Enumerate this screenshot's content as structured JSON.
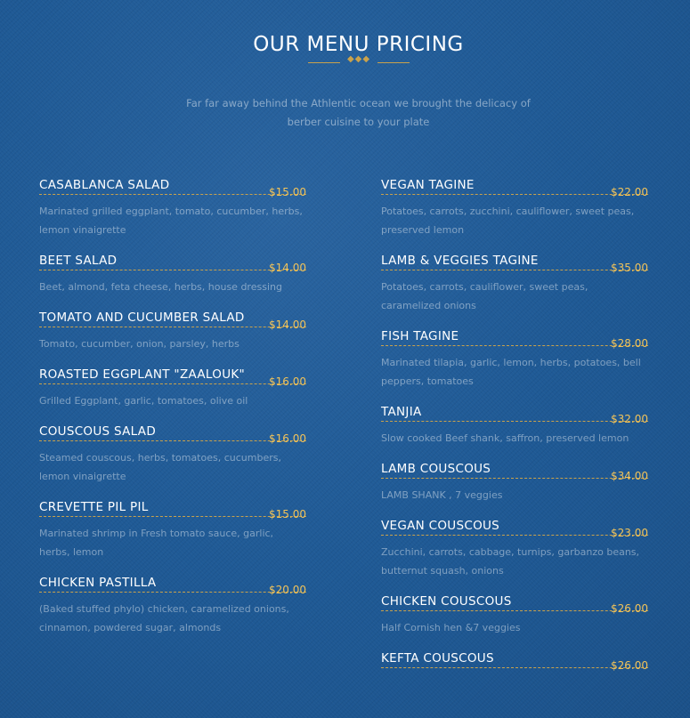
{
  "header": {
    "title": "OUR MENU PRICING",
    "subtitle": "Far far away behind the Athlentic ocean we brought the delicacy of berber cuisine to your plate",
    "divider_glyphs": "◆◆◆"
  },
  "colors": {
    "background": "#1f5a96",
    "accent_gold": "#c9a24c",
    "price": "#f1c35a"
  },
  "menu": {
    "left": [
      {
        "name": "CASABLANCA SALAD",
        "price": "$15.00",
        "desc": "Marinated grilled eggplant, tomato, cucumber, herbs, lemon vinaigrette"
      },
      {
        "name": "BEET SALAD",
        "price": "$14.00",
        "desc": "Beet, almond, feta cheese, herbs, house dressing"
      },
      {
        "name": "TOMATO AND CUCUMBER SALAD",
        "price": "$14.00",
        "desc": "Tomato, cucumber, onion, parsley, herbs"
      },
      {
        "name": "ROASTED EGGPLANT \"ZAALOUK\"",
        "price": "$16.00",
        "desc": "Grilled Eggplant, garlic, tomatoes, olive oil"
      },
      {
        "name": "COUSCOUS SALAD",
        "price": "$16.00",
        "desc": "Steamed couscous, herbs, tomatoes, cucumbers, lemon vinaigrette"
      },
      {
        "name": "CREVETTE PIL PIL",
        "price": "$15.00",
        "desc": "Marinated shrimp in Fresh tomato sauce, garlic, herbs, lemon"
      },
      {
        "name": "CHICKEN PASTILLA",
        "price": "$20.00",
        "desc": "(Baked stuffed phylo) chicken, caramelized onions, cinnamon, powdered sugar, almonds"
      }
    ],
    "right": [
      {
        "name": "VEGAN TAGINE",
        "price": "$22.00",
        "desc": "Potatoes, carrots, zucchini, cauliflower, sweet peas, preserved lemon"
      },
      {
        "name": "LAMB & VEGGIES TAGINE",
        "price": "$35.00",
        "desc": "Potatoes, carrots, cauliflower, sweet peas, caramelized onions"
      },
      {
        "name": "FISH TAGINE",
        "price": "$28.00",
        "desc": "Marinated tilapia, garlic, lemon, herbs, potatoes, bell peppers, tomatoes"
      },
      {
        "name": "TANJIA",
        "price": "$32.00",
        "desc": "Slow cooked Beef shank, saffron, preserved lemon"
      },
      {
        "name": "LAMB COUSCOUS",
        "price": "$34.00",
        "desc": "LAMB SHANK , 7 veggies"
      },
      {
        "name": "VEGAN COUSCOUS",
        "price": "$23.00",
        "desc": "Zucchini, carrots, cabbage, turnips, garbanzo beans, butternut squash, onions"
      },
      {
        "name": "CHICKEN COUSCOUS",
        "price": "$26.00",
        "desc": "Half Cornish hen &7 veggies"
      },
      {
        "name": "KEFTA COUSCOUS",
        "price": "$26.00",
        "desc": ""
      }
    ]
  }
}
